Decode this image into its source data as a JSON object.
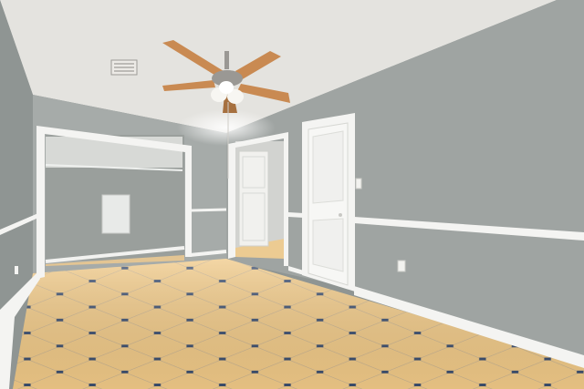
{
  "scene": {
    "colors": {
      "ceiling": "#e4e3df",
      "wall_back": "#a6aba9",
      "wall_right": "#9fa4a2",
      "wall_left": "#8f9593",
      "closet_interior": "#9a9f9c",
      "trim": "#f4f4f2",
      "floor_tile": "#f0c987",
      "grout": "#c9b38f",
      "floor_motif": "#3a4d6e",
      "fan_blade": "#c98a52",
      "fan_metal": "#9a9894",
      "fan_light": "#f7f6f2"
    },
    "icons": {
      "fan": "ceiling-fan-icon",
      "vent": "air-vent-icon",
      "switch": "light-switch-icon",
      "outlet": "power-outlet-icon"
    }
  }
}
